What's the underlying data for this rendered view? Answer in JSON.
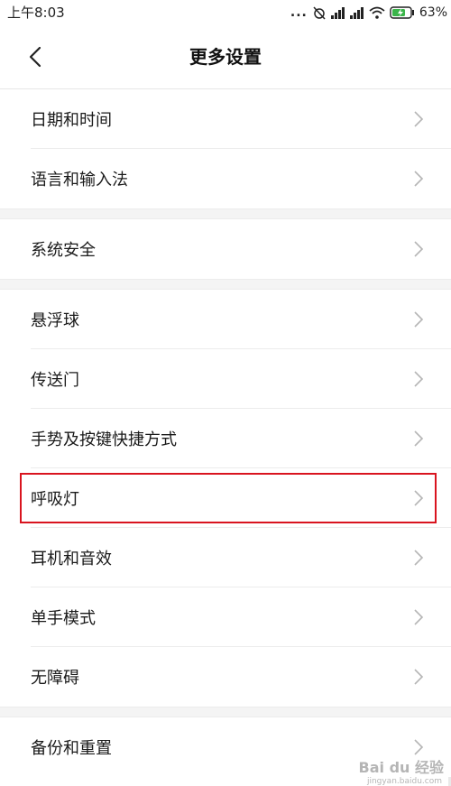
{
  "status_bar": {
    "time": "上午8:03",
    "dots": "...",
    "battery_percent": "63%"
  },
  "header": {
    "title": "更多设置"
  },
  "groups": [
    {
      "items": [
        {
          "label": "日期和时间"
        },
        {
          "label": "语言和输入法"
        }
      ]
    },
    {
      "items": [
        {
          "label": "系统安全"
        }
      ]
    },
    {
      "items": [
        {
          "label": "悬浮球"
        },
        {
          "label": "传送门"
        },
        {
          "label": "手势及按键快捷方式"
        },
        {
          "label": "呼吸灯",
          "highlighted": true
        },
        {
          "label": "耳机和音效"
        },
        {
          "label": "单手模式"
        },
        {
          "label": "无障碍"
        }
      ]
    },
    {
      "items": [
        {
          "label": "备份和重置"
        }
      ]
    }
  ],
  "watermark": {
    "text": "Bai du 经验",
    "sub": "jingyan.baidu.com"
  },
  "colors": {
    "highlight_border": "#d9141f",
    "battery_green": "#3bb54a"
  }
}
